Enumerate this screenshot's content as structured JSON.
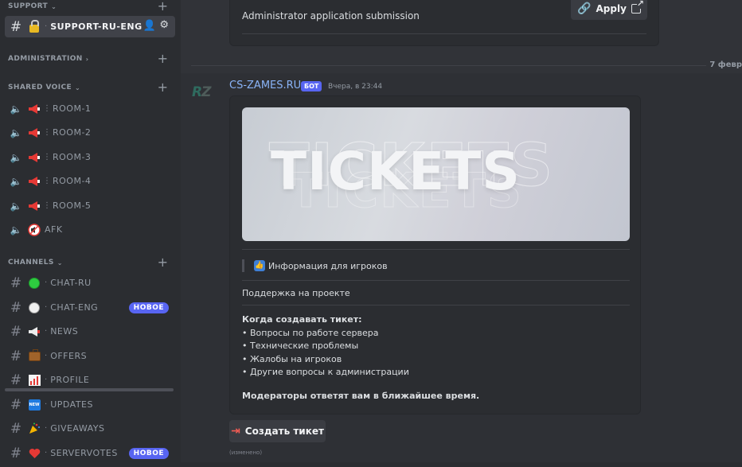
{
  "sidebar": {
    "categories": {
      "support": "SUPPORT",
      "administration": "ADMINISTRATION",
      "shared_voice": "SHARED VOICE",
      "channels": "CHANNELS"
    },
    "active_channel": "SUPPORT-RU-ENG",
    "voice_rooms": [
      "ROOM-1",
      "ROOM-2",
      "ROOM-3",
      "ROOM-4",
      "ROOM-5",
      "AFK"
    ],
    "channels": [
      {
        "name": "CHAT-RU",
        "icon": "green-circle-icon"
      },
      {
        "name": "CHAT-ENG",
        "icon": "white-circle-icon",
        "badge": "НОВОЕ"
      },
      {
        "name": "NEWS",
        "icon": "megaphone-icon"
      },
      {
        "name": "OFFERS",
        "icon": "briefcase-icon"
      },
      {
        "name": "PROFILE",
        "icon": "chart-icon"
      },
      {
        "name": "UPDATES",
        "icon": "new-icon"
      },
      {
        "name": "GIVEAWAYS",
        "icon": "party-popper-icon"
      },
      {
        "name": "SERVERVOTES",
        "icon": "heart-icon",
        "badge": "НОВОЕ"
      }
    ]
  },
  "main": {
    "prev_embed_text": "Administrator application submission",
    "apply_label": "Apply",
    "divider_date": "7 февр",
    "author": "CS-ZAMES.RU",
    "bot_tag": "БОТ",
    "timestamp": "Вчера, в 23:44",
    "avatar_text_r": "R",
    "avatar_text_z": "Z",
    "banner_text": "TICKETS",
    "field_title": "Информация для игроков",
    "support_text": "Поддержка на проекте",
    "when_title": "Когда создавать тикет:",
    "when_items": [
      "• Вопросы по работе сервера",
      "• Технические проблемы",
      "• Жалобы на игроков",
      "• Другие вопросы к администрации"
    ],
    "mods_text": "Модераторы ответят вам в ближайшее время.",
    "ticket_button": "Создать тикет",
    "edited": "(изменено)"
  },
  "colors": {
    "accent": "#5865f2",
    "author": "#8ab4f8",
    "sidebar_bg": "#2b2d31",
    "main_bg": "#313338"
  }
}
